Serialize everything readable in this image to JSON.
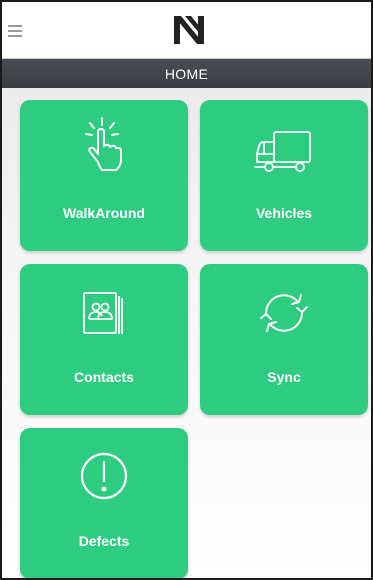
{
  "header": {
    "menu_icon": "hamburger-menu-icon",
    "logo_icon": "brand-logo-n"
  },
  "titlebar": {
    "title": "HOME"
  },
  "tiles": [
    {
      "label": "WalkAround",
      "icon": "tap-hand-icon"
    },
    {
      "label": "Vehicles",
      "icon": "truck-icon"
    },
    {
      "label": "Contacts",
      "icon": "address-book-icon"
    },
    {
      "label": "Sync",
      "icon": "sync-icon"
    },
    {
      "label": "Defects",
      "icon": "exclamation-circle-icon"
    }
  ],
  "colors": {
    "tile_green": "#2ecc80",
    "titlebar_dark": "#3f4348",
    "icon_white": "#ffffff"
  }
}
